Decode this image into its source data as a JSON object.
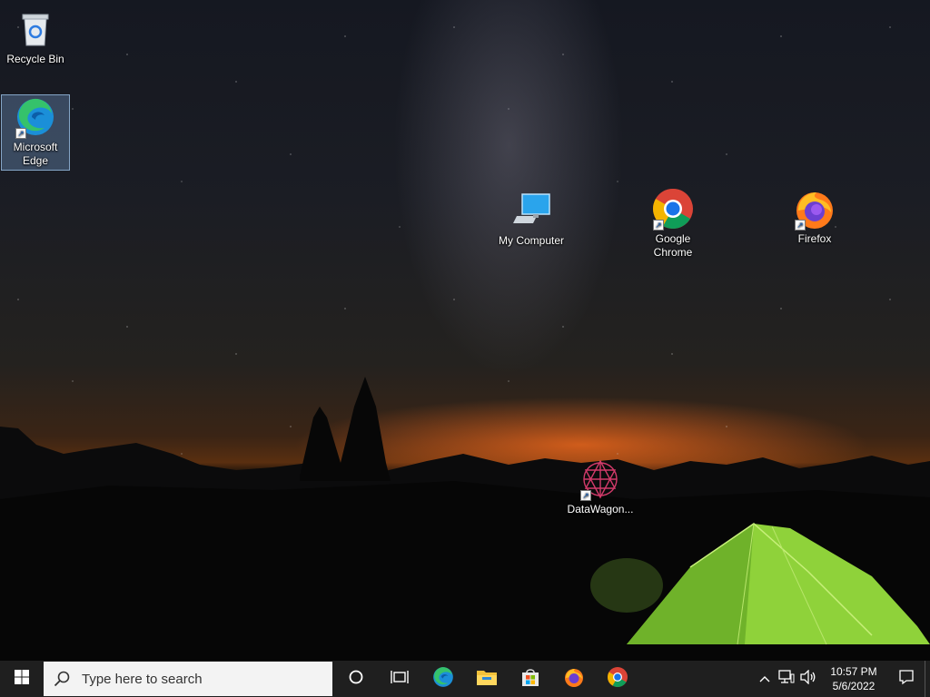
{
  "desktop": {
    "icons": [
      {
        "label": "Recycle Bin",
        "icon": "recycle-bin-icon"
      },
      {
        "label": "Microsoft Edge",
        "icon": "edge-icon",
        "selected": true
      },
      {
        "label": "My Computer",
        "icon": "computer-icon"
      },
      {
        "label": "Google Chrome",
        "icon": "chrome-icon"
      },
      {
        "label": "Firefox",
        "icon": "firefox-icon"
      },
      {
        "label": "DataWagon...",
        "icon": "datawagon-icon"
      }
    ]
  },
  "taskbar": {
    "search_placeholder": "Type here to search",
    "pinned": [
      "cortana-icon",
      "task-view-icon",
      "edge-icon",
      "file-explorer-icon",
      "store-icon",
      "firefox-icon",
      "chrome-icon"
    ],
    "clock": {
      "time": "10:57 PM",
      "date": "5/6/2022"
    }
  },
  "colors": {
    "taskbar": "#1f1f1f",
    "search_box": "#f3f3f3",
    "selection": "#78a0d2"
  }
}
